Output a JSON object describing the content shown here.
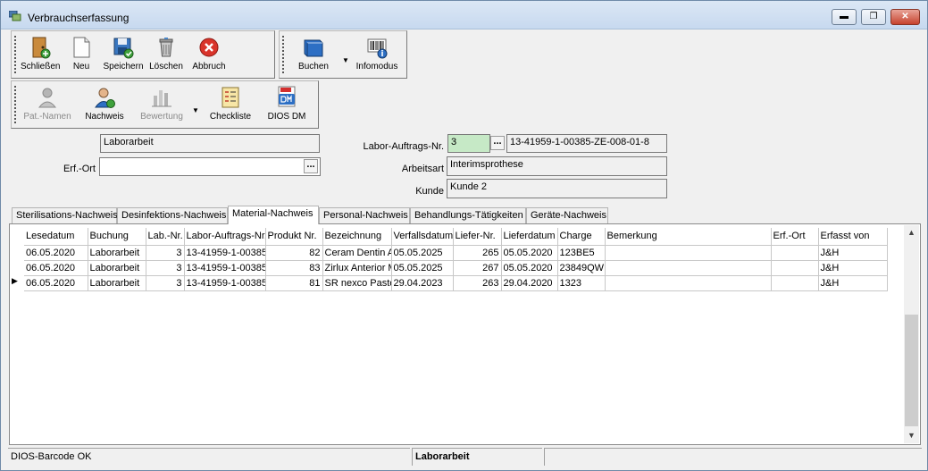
{
  "window": {
    "title": "Verbrauchserfassung",
    "minimize_glyph": "▬",
    "maximize_glyph": "❐",
    "close_glyph": "✕"
  },
  "toolbar_main": {
    "items": [
      {
        "label": "Schließen",
        "icon": "exit-door-icon"
      },
      {
        "label": "Neu",
        "icon": "new-document-icon"
      },
      {
        "label": "Speichern",
        "icon": "save-disk-icon"
      },
      {
        "label": "Löschen",
        "icon": "trash-can-icon"
      },
      {
        "label": "Abbruch",
        "icon": "cancel-icon"
      }
    ]
  },
  "toolbar_book": {
    "items": [
      {
        "label": "Buchen",
        "icon": "book-icon"
      },
      {
        "label": "Infomodus",
        "icon": "barcode-info-icon"
      }
    ]
  },
  "toolbar_second": {
    "items": [
      {
        "label": "Pat.-Namen",
        "icon": "patient-icon",
        "disabled": true
      },
      {
        "label": "Nachweis",
        "icon": "user-proof-icon",
        "disabled": false
      },
      {
        "label": "Bewertung",
        "icon": "rating-icon",
        "disabled": true
      },
      {
        "label": "Checkliste",
        "icon": "checklist-icon",
        "disabled": false
      },
      {
        "label": "DIOS DM",
        "icon": "pdf-dm-icon",
        "disabled": false
      }
    ]
  },
  "form": {
    "type_value": "Laborarbeit",
    "erf_ort_label": "Erf.-Ort",
    "erf_ort_value": "",
    "labor_auftrag_label": "Labor-Auftrags-Nr.",
    "labor_auftrag_nr": "3",
    "labor_auftrag_full": "13-41959-1-00385-ZE-008-01-8",
    "arbeitsart_label": "Arbeitsart",
    "arbeitsart_value": "Interimsprothese",
    "kunde_label": "Kunde",
    "kunde_value": "Kunde 2",
    "ellipsis": "..."
  },
  "tabs": [
    {
      "label": "Sterilisations-Nachweis",
      "active": false
    },
    {
      "label": "Desinfektions-Nachweis",
      "active": false
    },
    {
      "label": "Material-Nachweis",
      "active": true
    },
    {
      "label": "Personal-Nachweis",
      "active": false
    },
    {
      "label": "Behandlungs-Tätigkeiten",
      "active": false
    },
    {
      "label": "Geräte-Nachweis",
      "active": false
    }
  ],
  "grid": {
    "columns": [
      "Lesedatum",
      "Buchung",
      "Lab.-Nr.",
      "Labor-Auftrags-Nr.",
      "Produkt Nr.",
      "Bezeichnung",
      "Verfallsdatum",
      "Liefer-Nr.",
      "Lieferdatum",
      "Charge",
      "Bemerkung",
      "Erf.-Ort",
      "Erfasst von"
    ],
    "rows": [
      [
        "06.05.2020",
        "Laborarbeit",
        "3",
        "13-41959-1-00385",
        "82",
        "Ceram Dentin A",
        "05.05.2025",
        "265",
        "05.05.2020",
        "123BE5",
        "",
        "",
        "J&H"
      ],
      [
        "06.05.2020",
        "Laborarbeit",
        "3",
        "13-41959-1-00385",
        "83",
        "Zirlux Anterior M",
        "05.05.2025",
        "267",
        "05.05.2020",
        "23849QW",
        "",
        "",
        "J&H"
      ],
      [
        "06.05.2020",
        "Laborarbeit",
        "3",
        "13-41959-1-00385",
        "81",
        "SR nexco Paste",
        "29.04.2023",
        "263",
        "29.04.2020",
        "1323",
        "",
        "",
        "J&H"
      ]
    ],
    "current_row_marker": "▶",
    "scroll_up": "▲",
    "scroll_down": "▼"
  },
  "status": {
    "left": "DIOS-Barcode OK",
    "middle": "Laborarbeit",
    "right": ""
  }
}
